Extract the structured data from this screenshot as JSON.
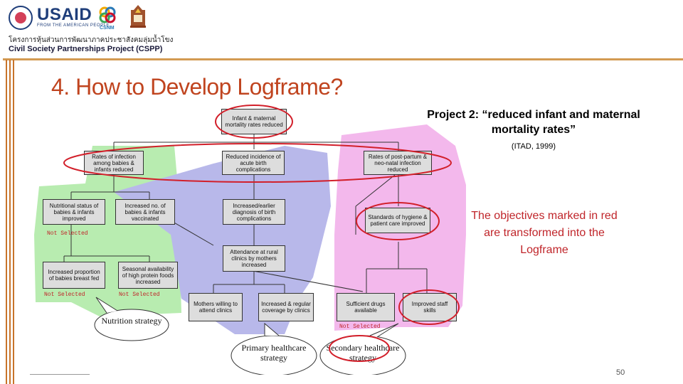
{
  "header": {
    "usaid_word": "USAID",
    "usaid_sub": "FROM THE AMERICAN PEOPLE",
    "csnm_word": "CSNM",
    "thai_line": "โครงการหุ้นส่วนการพัฒนาภาคประชาสังคมลุ่มน้ำโขง",
    "cspp_line": "Civil Society Partnerships Project (CSPP)"
  },
  "slide": {
    "title": "4. How to Develop Logframe?",
    "project_title": "Project 2: “reduced infant and maternal mortality rates”",
    "citation": "(ITAD, 1999)",
    "red_note": "The objectives marked in red are transformed into the Logframe",
    "page_number": "50"
  },
  "diagram": {
    "nodes": {
      "goal": "Infant & maternal mortality rates reduced",
      "infection": "Rates of infection among babies & infants reduced",
      "birth_comp": "Reduced incidence of acute birth complications",
      "postpartum": "Rates of post-partum & neo-natal infection reduced",
      "nutrition_status": "Nutritional status of babies & infants improved",
      "vaccinated": "Increased no. of babies & infants vaccinated",
      "diagnosis": "Increased/earlier diagnosis of birth complications",
      "hygiene": "Standards of hygiene & patient care improved",
      "attendance": "Attendance at rural clinics by mothers increased",
      "breast_fed": "Increased proportion of babies breast fed",
      "seasonal": "Seasonal availability of high protein foods increased",
      "mothers_willing": "Mothers willing to attend clinics",
      "regular_coverage": "Increased & regular coverage by clinics",
      "drugs": "Sufficient drugs available",
      "staff_skills": "Improved staff skills"
    },
    "not_selected": "Not Selected",
    "bubbles": {
      "nutrition": "Nutrition strategy",
      "primary": "Primary healthcare strategy",
      "secondary": "Secondary healthcare strategy"
    }
  }
}
